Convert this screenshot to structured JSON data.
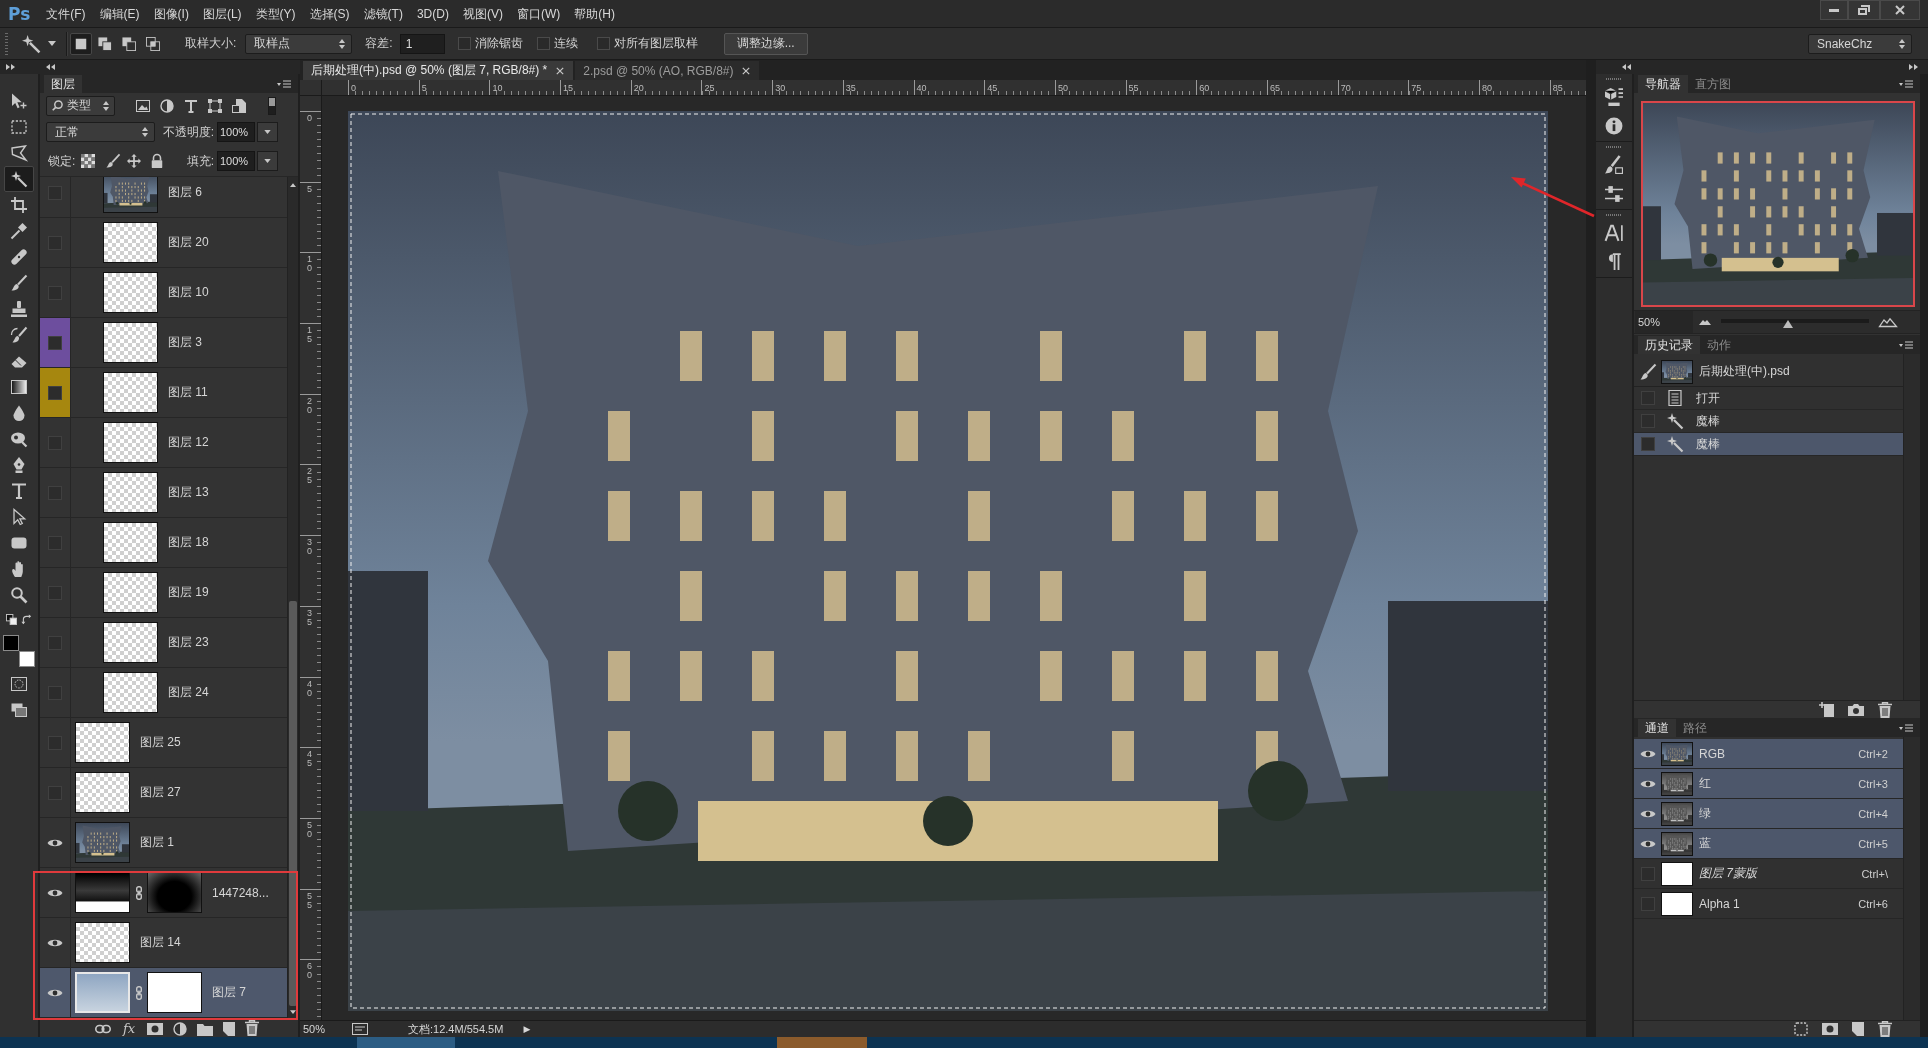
{
  "menu_bar": {
    "logo": "Ps",
    "items": [
      "文件(F)",
      "编辑(E)",
      "图像(I)",
      "图层(L)",
      "类型(Y)",
      "选择(S)",
      "滤镜(T)",
      "3D(D)",
      "视图(V)",
      "窗口(W)",
      "帮助(H)"
    ]
  },
  "options_bar": {
    "selection_modes": [
      {
        "selected": true
      },
      {
        "selected": false
      },
      {
        "selected": false
      },
      {
        "selected": false
      }
    ],
    "sample_size": {
      "label": "取样大小:",
      "value": "取样点"
    },
    "tolerance": {
      "label": "容差:",
      "value": "1"
    },
    "checkboxes": [
      {
        "label": "消除锯齿",
        "checked": false
      },
      {
        "label": "连续",
        "checked": false
      },
      {
        "label": "对所有图层取样",
        "checked": false
      }
    ],
    "refine_edge_button": "调整边缘...",
    "workspace": "SnakeChz"
  },
  "toolbox": {
    "tools": [
      {
        "selected": false
      },
      {
        "selected": false
      },
      {
        "selected": false
      },
      {
        "selected": true
      },
      {
        "selected": false
      },
      {
        "selected": false
      },
      {
        "selected": false
      },
      {
        "selected": false
      },
      {
        "selected": false
      },
      {
        "selected": false
      },
      {
        "selected": false
      },
      {
        "selected": false
      },
      {
        "selected": false
      },
      {
        "selected": false
      },
      {
        "selected": false
      },
      {
        "selected": false
      },
      {
        "selected": false
      },
      {
        "selected": false
      },
      {
        "selected": false
      },
      {
        "selected": false
      }
    ],
    "color_swatches": [
      {
        "color": "#000000"
      },
      {
        "color": "#ffffff"
      }
    ]
  },
  "layers_panel": {
    "tabs": [
      {
        "label": "图层",
        "selected": true
      }
    ],
    "filter": "类型",
    "blend_mode": "正常",
    "opacity": {
      "label": "不透明度:",
      "value": "100%"
    },
    "lock_label": "锁定:",
    "fill": {
      "label": "填充:",
      "value": "100%"
    },
    "layers": [
      {
        "children": [
          {
            "name": "图层 6",
            "visible": false,
            "selected": false,
            "kind": "photo",
            "mask": false
          },
          {
            "name": "图层 20",
            "visible": false,
            "selected": false,
            "kind": "transparent",
            "mask": false
          },
          {
            "name": "图层 10",
            "visible": false,
            "selected": false,
            "kind": "transparent",
            "mask": false
          },
          {
            "name": "图层 3",
            "visible": false,
            "selected": false,
            "kind": "transparent",
            "mask": false,
            "color": "#6d4e9e"
          },
          {
            "name": "图层 11",
            "visible": false,
            "selected": false,
            "kind": "transparent",
            "mask": false,
            "color": "#a6870f"
          },
          {
            "name": "图层 12",
            "visible": false,
            "selected": false,
            "kind": "transparent",
            "mask": false
          },
          {
            "name": "图层 13",
            "visible": false,
            "selected": false,
            "kind": "transparent",
            "mask": false
          },
          {
            "name": "图层 18",
            "visible": false,
            "selected": false,
            "kind": "transparent",
            "mask": false
          },
          {
            "name": "图层 19",
            "visible": false,
            "selected": false,
            "kind": "transparent",
            "mask": false
          },
          {
            "name": "图层 23",
            "visible": false,
            "selected": false,
            "kind": "transparent",
            "mask": false
          },
          {
            "name": "图层 24",
            "visible": false,
            "selected": false,
            "kind": "transparent",
            "mask": false
          }
        ]
      },
      {
        "name": "图层 25",
        "visible": false,
        "selected": false,
        "kind": "transparent",
        "mask": false
      },
      {
        "name": "图层 27",
        "visible": false,
        "selected": false,
        "kind": "transparent",
        "mask": false
      },
      {
        "name": "图层 1",
        "visible": true,
        "selected": false,
        "kind": "photo",
        "mask": false
      },
      {
        "name": "1447248...",
        "visible": true,
        "selected": false,
        "kind": "dark",
        "mask": true
      },
      {
        "name": "图层 14",
        "visible": true,
        "selected": false,
        "kind": "transparent",
        "mask": false
      },
      {
        "name": "图层 7",
        "visible": true,
        "selected": true,
        "kind": "sky",
        "mask": true
      }
    ],
    "fx_label": "fx"
  },
  "document_tabs": [
    {
      "title": "后期处理(中).psd @ 50% (图层 7, RGB/8#) *",
      "selected": true
    },
    {
      "title": "2.psd @ 50% (AO, RGB/8#)",
      "selected": false
    }
  ],
  "rulers": {
    "horizontal": [
      "0",
      "5",
      "10",
      "15",
      "20",
      "25",
      "30",
      "35",
      "40",
      "45",
      "50",
      "55",
      "60",
      "65",
      "70",
      "75",
      "80",
      "85"
    ],
    "vertical": [
      "0",
      "5",
      "10",
      "15",
      "20",
      "25",
      "30",
      "35",
      "40",
      "45",
      "50",
      "55",
      "60"
    ]
  },
  "status_bar": {
    "zoom": "50%",
    "document_size": "文档:12.4M/554.5M",
    "menu_arrow": "▶"
  },
  "navigator": {
    "tabs": [
      {
        "label": "导航器",
        "selected": true
      },
      {
        "label": "直方图",
        "selected": false
      }
    ],
    "zoom": "50%",
    "zoom_slider": {
      "level": 0.45
    }
  },
  "history": {
    "tabs": [
      {
        "label": "历史记录",
        "selected": true
      },
      {
        "label": "动作",
        "selected": false
      }
    ],
    "snapshot": "后期处理(中).psd",
    "steps": [
      {
        "label": "打开",
        "kind": "open",
        "selected": false
      },
      {
        "label": "魔棒",
        "kind": "wand",
        "selected": false
      },
      {
        "label": "魔棒",
        "kind": "wand",
        "selected": true
      }
    ]
  },
  "channels": {
    "tabs": [
      {
        "label": "通道",
        "selected": true
      },
      {
        "label": "路径",
        "selected": false
      }
    ],
    "rows": [
      {
        "name": "RGB",
        "shortcut": "Ctrl+2",
        "kind": "composite",
        "visible": true,
        "selected": true
      },
      {
        "name": "红",
        "shortcut": "Ctrl+3",
        "kind": "color",
        "visible": true,
        "selected": true
      },
      {
        "name": "绿",
        "shortcut": "Ctrl+4",
        "kind": "color",
        "visible": true,
        "selected": true
      },
      {
        "name": "蓝",
        "shortcut": "Ctrl+5",
        "kind": "color",
        "visible": true,
        "selected": true
      },
      {
        "name": "图层 7蒙版",
        "shortcut": "Ctrl+\\",
        "kind": "mask",
        "visible": false,
        "selected": false
      },
      {
        "name": "Alpha 1",
        "shortcut": "Ctrl+6",
        "kind": "alpha",
        "visible": false,
        "selected": false
      }
    ]
  }
}
